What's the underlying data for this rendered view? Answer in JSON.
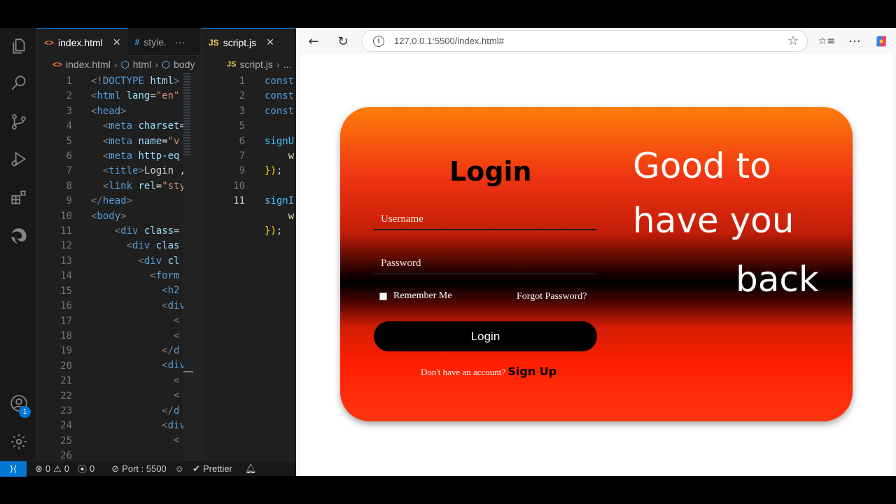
{
  "editor": {
    "tabs": [
      {
        "label": "index.html",
        "icon": "<>",
        "close": "✕"
      },
      {
        "label": "style.",
        "icon": "#",
        "more": "···"
      }
    ],
    "tab2": {
      "label": "script.js",
      "icon": "JS",
      "close": "✕"
    },
    "breadcrumb1": [
      "index.html",
      "html",
      "body"
    ],
    "breadcrumb2": [
      "script.js",
      "..."
    ],
    "line_numbers_1": [
      "1",
      "2",
      "3",
      "4",
      "5",
      "6",
      "7",
      "8",
      "9",
      "10",
      "11",
      "12",
      "13",
      "14",
      "15",
      "16",
      "17",
      "18",
      "19",
      "20",
      "21",
      "22",
      "23",
      "24",
      "25",
      "26"
    ],
    "line_numbers_2": [
      "1",
      "2",
      "3",
      "",
      "5",
      "6",
      "7",
      "",
      "9",
      "10",
      "11"
    ],
    "code1": [
      [
        [
          "tg",
          "<!"
        ],
        [
          "tn",
          "DOCTYPE"
        ],
        [
          "tx",
          " "
        ],
        [
          "at",
          "html"
        ],
        [
          "tg",
          ">"
        ]
      ],
      [
        [
          "tg",
          "<"
        ],
        [
          "tn",
          "html"
        ],
        [
          "tx",
          " "
        ],
        [
          "at",
          "lang"
        ],
        [
          "tx",
          "="
        ],
        [
          "av",
          "\"en\""
        ]
      ],
      [
        [
          "tg",
          "<"
        ],
        [
          "tn",
          "head"
        ],
        [
          "tg",
          ">"
        ]
      ],
      [
        [
          "tx",
          "  "
        ],
        [
          "tg",
          "<"
        ],
        [
          "tn",
          "meta"
        ],
        [
          "tx",
          " "
        ],
        [
          "at",
          "charset"
        ],
        [
          "tx",
          "="
        ]
      ],
      [
        [
          "tx",
          "  "
        ],
        [
          "tg",
          "<"
        ],
        [
          "tn",
          "meta"
        ],
        [
          "tx",
          " "
        ],
        [
          "at",
          "name"
        ],
        [
          "tx",
          "="
        ],
        [
          "av",
          "\"v"
        ]
      ],
      [
        [
          "tx",
          "  "
        ],
        [
          "tg",
          "<"
        ],
        [
          "tn",
          "meta"
        ],
        [
          "tx",
          " "
        ],
        [
          "at",
          "http-eq"
        ]
      ],
      [
        [
          "tx",
          "  "
        ],
        [
          "tg",
          "<"
        ],
        [
          "tn",
          "title"
        ],
        [
          "tg",
          ">"
        ],
        [
          "tx",
          "Login ,"
        ]
      ],
      [
        [
          "tx",
          "  "
        ],
        [
          "tg",
          "<"
        ],
        [
          "tn",
          "link"
        ],
        [
          "tx",
          " "
        ],
        [
          "at",
          "rel"
        ],
        [
          "tx",
          "="
        ],
        [
          "av",
          "\"sty"
        ]
      ],
      [
        [
          "tg",
          "</"
        ],
        [
          "tn",
          "head"
        ],
        [
          "tg",
          ">"
        ]
      ],
      [
        [
          "tg",
          "<"
        ],
        [
          "tn",
          "body"
        ],
        [
          "tg",
          ">"
        ]
      ],
      [
        [
          "tx",
          "    "
        ],
        [
          "tg",
          "<"
        ],
        [
          "tn",
          "div"
        ],
        [
          "tx",
          " "
        ],
        [
          "at",
          "class"
        ],
        [
          "tx",
          "="
        ]
      ],
      [
        [
          "tx",
          "      "
        ],
        [
          "tg",
          "<"
        ],
        [
          "tn",
          "div"
        ],
        [
          "tx",
          " "
        ],
        [
          "at",
          "clas"
        ]
      ],
      [
        [
          "tx",
          "        "
        ],
        [
          "tg",
          "<"
        ],
        [
          "tn",
          "div"
        ],
        [
          "tx",
          " "
        ],
        [
          "at",
          "cl"
        ]
      ],
      [
        [
          "tx",
          "          "
        ],
        [
          "tg",
          "<"
        ],
        [
          "tn",
          "form"
        ]
      ],
      [
        [
          "tx",
          "            "
        ],
        [
          "tg",
          "<"
        ],
        [
          "tn",
          "h2"
        ]
      ],
      [
        [
          "tx",
          "            "
        ],
        [
          "tg",
          "<"
        ],
        [
          "tn",
          "div"
        ]
      ],
      [
        [
          "tx",
          "              "
        ],
        [
          "tg",
          "<"
        ]
      ],
      [
        [
          "tx",
          "              "
        ],
        [
          "tg",
          "<"
        ]
      ],
      [
        [
          "tx",
          "            "
        ],
        [
          "tg",
          "</"
        ],
        [
          "tn",
          "d"
        ]
      ],
      [
        [
          "tx",
          "            "
        ],
        [
          "tg",
          "<"
        ],
        [
          "tn",
          "div"
        ]
      ],
      [
        [
          "tx",
          "              "
        ],
        [
          "tg",
          "<"
        ]
      ],
      [
        [
          "tx",
          "              "
        ],
        [
          "tg",
          "<"
        ]
      ],
      [
        [
          "tx",
          "            "
        ],
        [
          "tg",
          "</"
        ],
        [
          "tn",
          "d"
        ]
      ],
      [
        [
          "tx",
          "            "
        ],
        [
          "tg",
          "<"
        ],
        [
          "tn",
          "div"
        ]
      ],
      [
        [
          "tx",
          "              "
        ],
        [
          "tg",
          "<"
        ]
      ],
      [
        [
          "tx",
          ""
        ]
      ]
    ],
    "code2": [
      [
        [
          "kw",
          "const"
        ]
      ],
      [
        [
          "kw",
          "const"
        ]
      ],
      [
        [
          "kw",
          "const"
        ]
      ],
      [
        [
          "tx",
          ""
        ]
      ],
      [
        [
          "vr",
          "signU"
        ]
      ],
      [
        [
          "tx",
          "    "
        ],
        [
          "fn",
          "w"
        ]
      ],
      [
        [
          "yl",
          "})"
        ],
        [
          "tx",
          ";"
        ]
      ],
      [
        [
          "tx",
          ""
        ]
      ],
      [
        [
          "vr",
          "signI"
        ]
      ],
      [
        [
          "tx",
          "    "
        ],
        [
          "fn",
          "w"
        ]
      ],
      [
        [
          "yl",
          "})"
        ],
        [
          "tx",
          ";"
        ]
      ]
    ]
  },
  "status": {
    "errors": "0",
    "warnings": "0",
    "ports": "0",
    "port_label": "Port : 5500",
    "prettier": "Prettier",
    "account_badge": "1"
  },
  "browser": {
    "url": "127.0.0.1:5500/index.html#",
    "back": "←",
    "reload": "↻",
    "favorite": "☆",
    "favorites": "☆≡",
    "more": "···"
  },
  "page": {
    "login_title": "Login",
    "username_placeholder": "Username",
    "password_placeholder": "Password",
    "remember_label": "Remember Me",
    "forgot_link": "Forgot Password?",
    "login_button": "Login",
    "signup_prompt": "Don't have an account?",
    "signup_link": "Sign Up",
    "welcome_line1": "Good to",
    "welcome_line2": "have you",
    "welcome_line3": "back"
  }
}
